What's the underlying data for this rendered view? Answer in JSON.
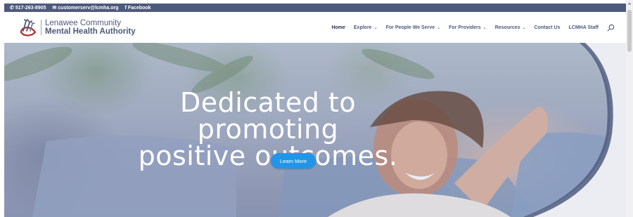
{
  "topbar": {
    "phone": "517-263-8905",
    "email": "customerserv@lcmha.org",
    "social": "Facebook",
    "icons": [
      "phone-icon",
      "mail-icon",
      "facebook-icon"
    ]
  },
  "logo": {
    "line1": "Lenawee Community",
    "line2": "Mental Health Authority"
  },
  "nav": {
    "items": [
      {
        "label": "Home",
        "dropdown": false,
        "active": true
      },
      {
        "label": "Explore",
        "dropdown": true
      },
      {
        "label": "For People We Serve",
        "dropdown": true
      },
      {
        "label": "For Providers",
        "dropdown": true
      },
      {
        "label": "Resources",
        "dropdown": true
      },
      {
        "label": "Contact Us",
        "dropdown": false
      },
      {
        "label": "LCMHA Staff",
        "dropdown": false
      }
    ],
    "search_icon": "search-icon"
  },
  "hero": {
    "title_line1": "Dedicated to promoting",
    "title_line2": "positive outcomes.",
    "cta_label": "Learn More"
  },
  "colors": {
    "brand": "#4e5a7b",
    "cta": "#2196e8",
    "accent_red": "#b22a2a"
  }
}
